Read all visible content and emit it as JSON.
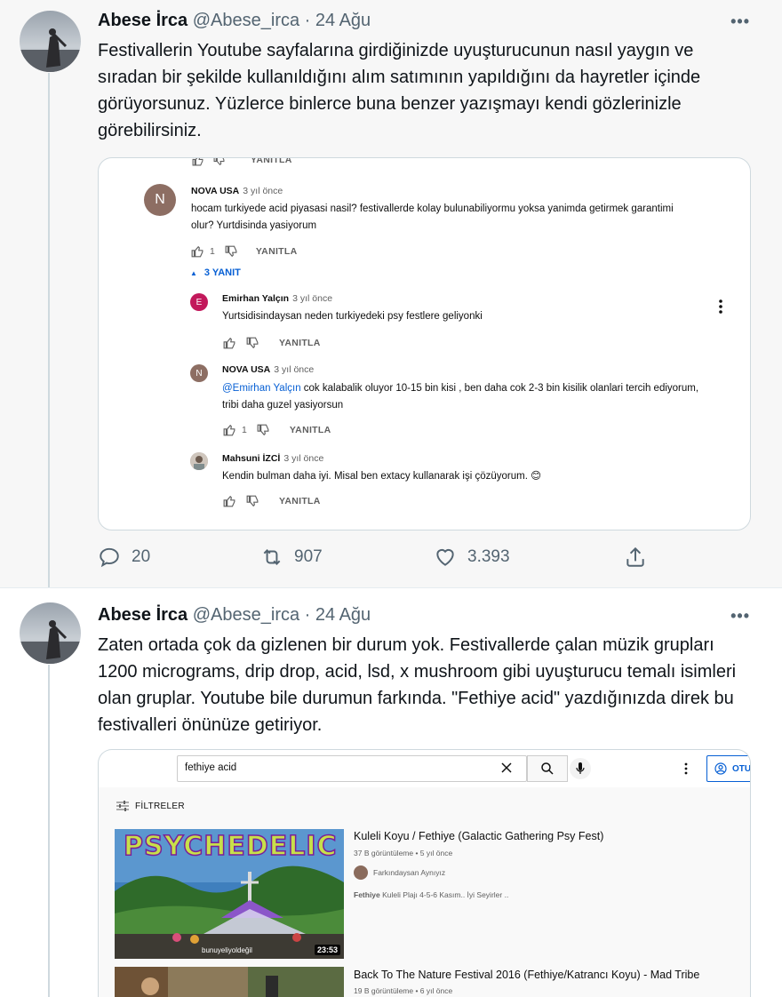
{
  "tweets": [
    {
      "name": "Abese İrca",
      "handle": "@Abese_irca · 24 Ağu",
      "text": "Festivallerin Youtube sayfalarına girdiğinizde uyuşturucunun nasıl yaygın ve sıradan bir şekilde kullanıldığını alım satımının yapıldığını da hayretler içinde görüyorsunuz. Yüzlerce binlerce buna benzer yazışmayı kendi gözlerinizle görebilirsiniz.",
      "replies": "20",
      "retweets": "907",
      "likes": "3.393"
    },
    {
      "name": "Abese İrca",
      "handle": "@Abese_irca · 24 Ağu",
      "text": "Zaten ortada çok da gizlenen bir durum yok. Festivallerde çalan müzik grupları 1200 micrograms, drip drop, acid, lsd, x mushroom gibi uyuşturucu temalı isimleri olan gruplar. Youtube bile durumun farkında. \"Fethiye acid\" yazdığınızda direk bu festivalleri önünüze getiriyor."
    }
  ],
  "comments": {
    "top_partial_reply": "YANITLA",
    "main": {
      "initial": "N",
      "author": "NOVA USA",
      "ago": "3 yıl önce",
      "text": "hocam turkiyede acid piyasasi nasil? festivallerde kolay bulunabiliyormu yoksa yanimda getirmek garantimi olur? Yurtdisinda yasiyorum",
      "likes": "1",
      "reply_label": "YANITLA"
    },
    "replies_toggle": "3 YANIT",
    "replies": [
      {
        "initial": "E",
        "author": "Emirhan Yalçın",
        "ago": "3 yıl önce",
        "text": "Yurtsidisindaysan neden turkiyedeki psy festlere geliyonki",
        "likes": "",
        "reply_label": "YANITLA"
      },
      {
        "initial": "N",
        "author": "NOVA USA",
        "ago": "3 yıl önce",
        "mention": "@Emirhan Yalçın",
        "text": "  cok kalabalik oluyor 10-15 bin kisi , ben daha cok 2-3 bin kisilik olanlari tercih ediyorum, tribi daha guzel yasiyorsun",
        "likes": "1",
        "reply_label": "YANITLA"
      },
      {
        "initial": "",
        "author": "Mahsuni İZCİ",
        "ago": "3 yıl önce",
        "text": "Kendin bulman daha iyi. Misal ben extacy kullanarak işi çözüyorum. 😊",
        "likes": "",
        "reply_label": "YANITLA"
      }
    ]
  },
  "youtube": {
    "search_value": "fethiye acid",
    "signin_label": "OTU",
    "filters_label": "FİLTRELER",
    "videos": [
      {
        "title": "Kuleli Koyu / Fethiye (Galactic Gathering Psy Fest)",
        "meta": "37 B görüntüleme • 5 yıl önce",
        "channel": "Farkındaysan Aynıyız",
        "desc_bold": "Fethiye",
        "desc": " Kuleli Plajı 4-5-6 Kasım.. İyi Seyirler ..",
        "thumb_text": "PSYCHEDELIC",
        "watermark": "bunuyeliyoldeğil",
        "duration": "23:53"
      },
      {
        "title": "Back To The Nature Festival 2016 (Fethiye/Katrancı Koyu) - Mad Tribe",
        "meta": "19 B görüntüleme • 6 yıl önce"
      }
    ]
  },
  "colors": {
    "twitter_gray": "#536471",
    "yt_link": "#065fd4",
    "avatar_nova": "#8d6e63",
    "avatar_emirhan": "#c2185b"
  }
}
